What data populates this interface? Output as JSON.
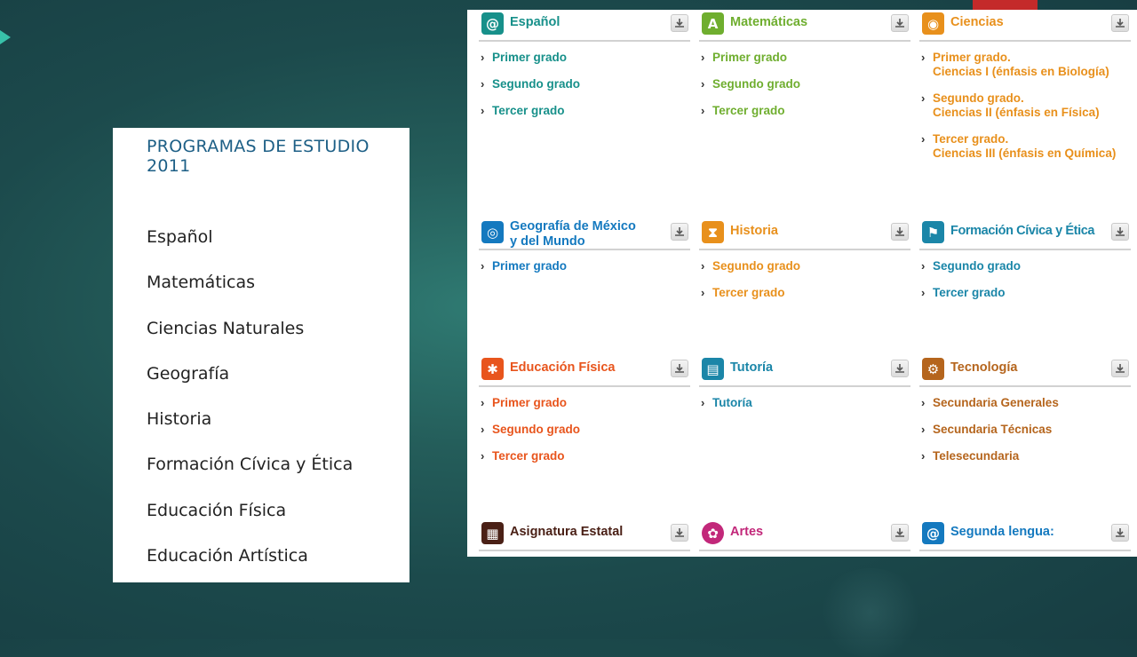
{
  "menu": {
    "title": "PROGRAMAS DE ESTUDIO 2011",
    "items": [
      "Español",
      "Matemáticas",
      "Ciencias Naturales",
      "Geografía",
      "Historia",
      "Formación Cívica y Ética",
      "Educación Física",
      "Educación Artística"
    ]
  },
  "subjects": {
    "espanol": {
      "title": "Español",
      "color": "#17908a",
      "icon": "spiral-icon",
      "links": [
        "Primer grado",
        "Segundo grado",
        "Tercer grado"
      ]
    },
    "matematicas": {
      "title": "Matemáticas",
      "color": "#6fae2f",
      "icon": "compass-icon",
      "links": [
        "Primer grado",
        "Segundo grado",
        "Tercer grado"
      ]
    },
    "ciencias": {
      "title": "Ciencias",
      "color": "#e8901c",
      "icon": "lightbulb-icon",
      "links": [
        {
          "line1": "Primer grado.",
          "line2": "Ciencias I (énfasis en Biología)"
        },
        {
          "line1": "Segundo grado.",
          "line2": "Ciencias II (énfasis en Física)"
        },
        {
          "line1": "Tercer grado.",
          "line2": "Ciencias III (énfasis en Química)"
        }
      ]
    },
    "geografia": {
      "title_line1": "Geografía de México",
      "title_line2": "y del Mundo",
      "color": "#1479bf",
      "icon": "globe-icon",
      "links": [
        "Primer grado"
      ]
    },
    "historia": {
      "title": "Historia",
      "color": "#e8901c",
      "icon": "hourglass-icon",
      "links": [
        "Segundo grado",
        "Tercer grado"
      ]
    },
    "civica": {
      "title": "Formación Cívica y Ética",
      "color": "#1b86a8",
      "icon": "flag-icon",
      "links": [
        "Segundo grado",
        "Tercer grado"
      ]
    },
    "fisica": {
      "title": "Educación Física",
      "color": "#e8551d",
      "icon": "runner-icon",
      "links": [
        "Primer grado",
        "Segundo grado",
        "Tercer grado"
      ]
    },
    "tutoria": {
      "title": "Tutoría",
      "color": "#1b86a8",
      "icon": "book-icon",
      "links": [
        "Tutoría"
      ]
    },
    "tecnologia": {
      "title": "Tecnología",
      "color": "#b5651d",
      "icon": "gear-icon",
      "links": [
        "Secundaria Generales",
        "Secundaria Técnicas",
        "Telesecundaria"
      ]
    },
    "estatal": {
      "title": "Asignatura Estatal",
      "color": "#4a2016",
      "icon": "clipboard-icon",
      "links": []
    },
    "artes": {
      "title": "Artes",
      "color": "#c2287a",
      "icon": "palette-icon",
      "links": []
    },
    "lengua": {
      "title": "Segunda lengua:",
      "color": "#1479bf",
      "icon": "spiral-icon",
      "links": []
    }
  }
}
